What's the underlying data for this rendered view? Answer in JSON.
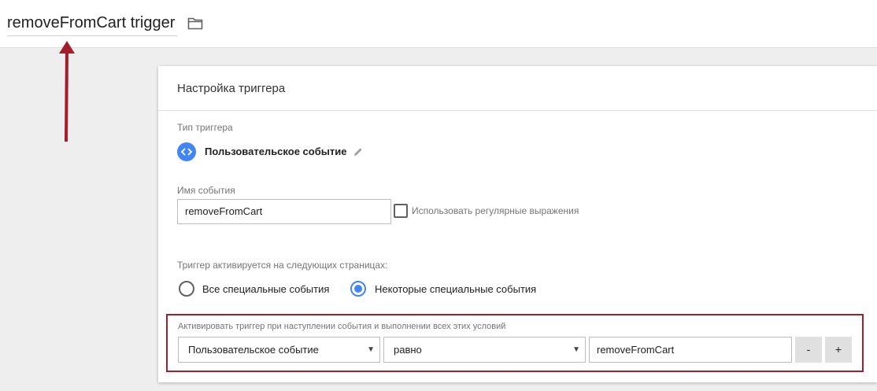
{
  "header": {
    "trigger_name": "removeFromCart trigger"
  },
  "card": {
    "title": "Настройка триггера",
    "trigger_type_label": "Тип триггера",
    "trigger_type_value": "Пользовательское событие",
    "event_name_label": "Имя события",
    "event_name_value": "removeFromCart",
    "regex_checkbox_label": "Использовать регулярные выражения",
    "regex_checked": false,
    "fires_on_label": "Триггер активируется на следующих страницах:",
    "radio_options": [
      {
        "label": "Все специальные события",
        "checked": false
      },
      {
        "label": "Некоторые специальные события",
        "checked": true
      }
    ],
    "condition": {
      "label": "Активировать триггер при наступлении события и выполнении всех этих условий",
      "variable": "Пользовательское событие",
      "operator": "равно",
      "value": "removeFromCart",
      "minus_label": "-",
      "plus_label": "+"
    }
  },
  "colors": {
    "accent": "#4285f4",
    "annotation": "#a31e2b"
  },
  "icons": [
    "folder-icon",
    "code-icon",
    "pencil-icon",
    "caret-down-icon",
    "arrow-annotation"
  ]
}
